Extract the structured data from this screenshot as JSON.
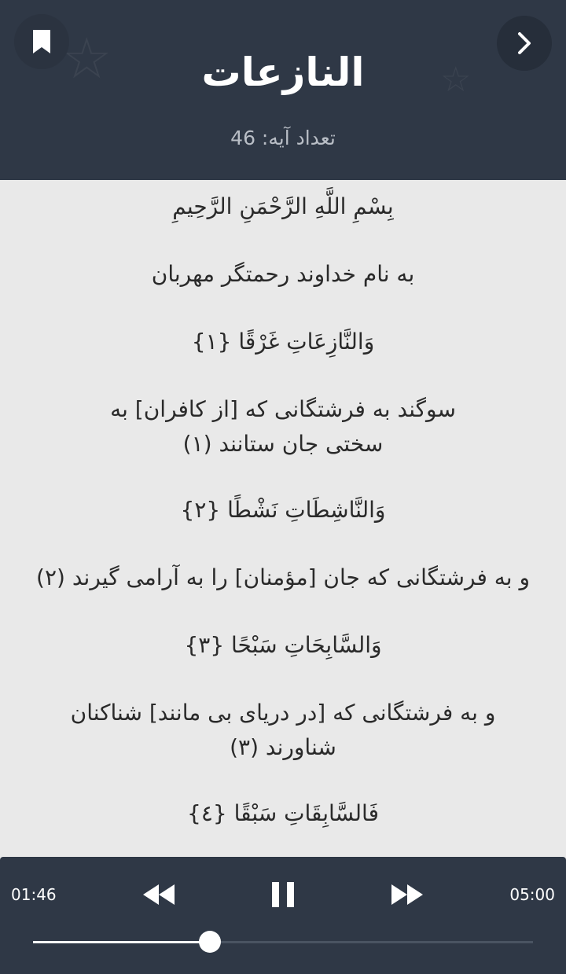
{
  "header": {
    "title": "النازعات",
    "ayah_count": "تعداد آیه: 46",
    "bookmark_icon": "bookmark-icon",
    "back_icon": "chevron-right-icon",
    "background": "#2f3846"
  },
  "verses": [
    {
      "text": "بِسْمِ اللَّهِ الرَّحْمَنِ الرَّحِيمِ",
      "kind": "arabic"
    },
    {
      "text": "به نام خداوند رحمتگر مهربان",
      "kind": "translation"
    },
    {
      "text": "وَالنَّازِعَاتِ غَرْقًا {١}",
      "kind": "arabic"
    },
    {
      "text": "سوگند به فرشتگانی که [از کافران] به سختی جان ستانند (۱)",
      "kind": "translation"
    },
    {
      "text": "وَالنَّاشِطَاتِ نَشْطًا {٢}",
      "kind": "arabic"
    },
    {
      "text": "و به فرشتگانی که جان [مؤمنان] را به آرامی گیرند (۲)",
      "kind": "translation"
    },
    {
      "text": "وَالسَّابِحَاتِ سَبْحًا {٣}",
      "kind": "arabic"
    },
    {
      "text": "و به فرشتگانی که [در دریای بی مانند] شناکنان شناورند (۳)",
      "kind": "translation"
    },
    {
      "text": "فَالسَّابِقَاتِ سَبْقًا {٤}",
      "kind": "arabic"
    }
  ],
  "player": {
    "current_time": "01:46",
    "total_time": "05:00",
    "progress": 0.353,
    "rewind_icon": "rewind-icon",
    "pause_icon": "pause-icon",
    "forward_icon": "fast-forward-icon"
  }
}
